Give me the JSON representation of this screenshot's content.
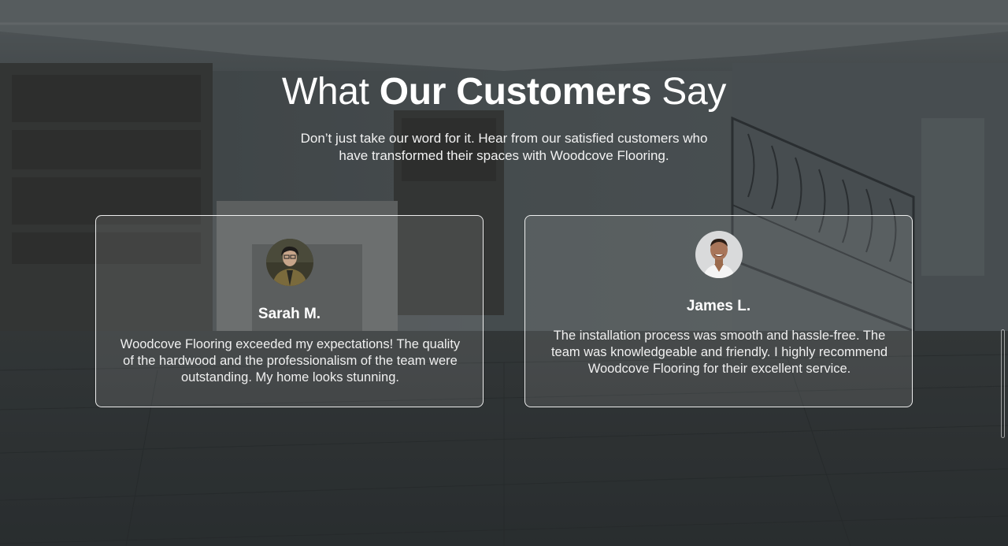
{
  "section": {
    "title_part1": "What ",
    "title_bold": "Our Customers",
    "title_part2": " Say",
    "subtitle": "Don’t just take our word for it. Hear from our satisfied customers who have transformed their spaces with Woodcove Flooring."
  },
  "testimonials": [
    {
      "name": "Sarah M.",
      "avatar_icon": "avatar-photo",
      "quote": "Woodcove Flooring exceeded my expectations! The quality of the hardwood and the professionalism of the team were outstanding. My home looks stunning."
    },
    {
      "name": "James L.",
      "avatar_icon": "avatar-photo",
      "quote": "The installation process was smooth and hassle-free. The team was knowledgeable and friendly. I highly recommend Woodcove Flooring for their excellent service."
    }
  ],
  "colors": {
    "overlay": "#262c30",
    "text": "#ffffff",
    "card_border": "#ffffff"
  }
}
